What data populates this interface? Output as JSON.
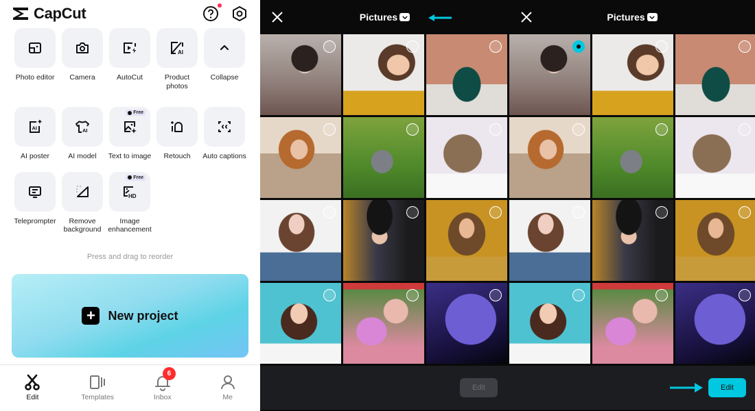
{
  "home": {
    "brand": "CapCut",
    "tools": [
      {
        "label": "Photo editor",
        "icon": "photo-editor-icon"
      },
      {
        "label": "Camera",
        "icon": "camera-icon"
      },
      {
        "label": "AutoCut",
        "icon": "autocut-icon"
      },
      {
        "label": "Product\nphotos",
        "icon": "product-photos-icon"
      },
      {
        "label": "Collapse",
        "icon": "chevron-up-icon"
      },
      {
        "label": "AI poster",
        "icon": "ai-poster-icon"
      },
      {
        "label": "AI model",
        "icon": "ai-model-icon"
      },
      {
        "label": "Text to image",
        "icon": "text-to-image-icon",
        "badge": "Free"
      },
      {
        "label": "Retouch",
        "icon": "retouch-icon"
      },
      {
        "label": "Auto captions",
        "icon": "auto-captions-icon"
      },
      {
        "label": "Teleprompter",
        "icon": "teleprompter-icon"
      },
      {
        "label": "Remove\nbackground",
        "icon": "remove-background-icon"
      },
      {
        "label": "Image\nenhancement",
        "icon": "image-enhancement-icon",
        "badge": "Free"
      }
    ],
    "hint": "Press and drag to reorder",
    "new_project": "New project",
    "nav": [
      {
        "label": "Edit",
        "active": true
      },
      {
        "label": "Templates"
      },
      {
        "label": "Inbox",
        "badge": "6"
      },
      {
        "label": "Me"
      }
    ]
  },
  "picker_before": {
    "title": "Pictures",
    "edit_label": "Edit",
    "edit_enabled": false,
    "selected": []
  },
  "picker_after": {
    "title": "Pictures",
    "edit_label": "Edit",
    "edit_enabled": true,
    "selected": [
      0
    ]
  },
  "photos": [
    "woman-with-flowers",
    "smiling-woman-yellow",
    "green-mug",
    "woman-beach",
    "kitten-grass",
    "tabby-kitten",
    "woman-flower-crown",
    "woman-black-beanie",
    "woman-golden-light",
    "woman-teal-background",
    "girl-pink-flowers",
    "anime-purple-figure"
  ],
  "colors": {
    "accent": "#00c8e0",
    "badge": "#fe2c2c",
    "picker_bg": "#0a0a0a",
    "footer_bg": "#1c1d21"
  }
}
